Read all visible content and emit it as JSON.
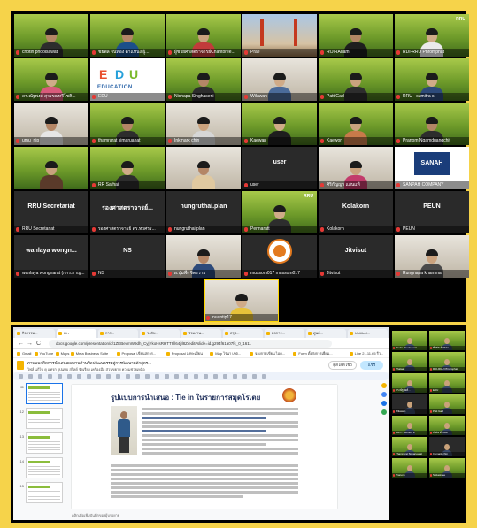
{
  "top_gallery": {
    "tiles": [
      {
        "name": "chotin phoolsawat",
        "style": "green",
        "person": true,
        "skin": "#b48666",
        "shirt": "#2d2d2d"
      },
      {
        "name": "ชัยพล จันทอง ตำแหน่ง ผู้...",
        "style": "green",
        "person": true,
        "skin": "#b48666",
        "shirt": "#1c4f8a"
      },
      {
        "name": "ผู้ช่วยศาสตราจารย์Chantoree...",
        "style": "green",
        "person": true,
        "skin": "#caa27e",
        "shirt": "#c23b3b"
      },
      {
        "name": "Prae",
        "style": "bridge",
        "person": false
      },
      {
        "name": "ROIRAdam",
        "style": "green",
        "person": true,
        "skin": "#b48666",
        "shirt": "#1e1e1e"
      },
      {
        "name": "RDI-RRU Phromphat",
        "style": "green",
        "person": true,
        "skin": "#d0ab88",
        "shirt": "#eaeaea",
        "logo": "RRU"
      },
      {
        "name": "ดร.ณัฐพงศ์ สุวรรณทวีโชติ...",
        "style": "green",
        "person": true,
        "skin": "#d0ab88",
        "shirt": "#d95b7b"
      },
      {
        "name": "EDU",
        "style": "edu",
        "person": false,
        "edu_sub": "EDUCATION"
      },
      {
        "name": "Nichapa Singhaseni",
        "style": "green",
        "person": true,
        "skin": "#b48666",
        "shirt": "#2d2d2d"
      },
      {
        "name": "Wilawan",
        "style": "photo",
        "person": true,
        "skin": "#d0ab88",
        "shirt": "#4b6b9a"
      },
      {
        "name": "Patt Gad",
        "style": "green",
        "person": true,
        "skin": "#caa27e",
        "shirt": "#2d2d2d"
      },
      {
        "name": "RRU - sumitra s.",
        "style": "green",
        "person": true,
        "skin": "#d0ab88",
        "shirt": "#2d4a7a"
      },
      {
        "name": "umu_nip",
        "style": "photo",
        "person": true,
        "skin": "#b48666",
        "shirt": "#e6e6e6"
      },
      {
        "name": "thamrarat simaruanat",
        "style": "green",
        "person": true,
        "skin": "#b48666",
        "shirt": "#2d2d2d"
      },
      {
        "name": "Inkmark chin",
        "style": "photo",
        "person": true,
        "skin": "#caa27e",
        "shirt": "#d6d6d6"
      },
      {
        "name": "Kaewan",
        "style": "green",
        "person": true,
        "skin": "#d0ab88",
        "shirt": "#1e1e1e"
      },
      {
        "name": "Kaewon",
        "style": "green",
        "person": true,
        "skin": "#caa27e",
        "shirt": "#c87a4a"
      },
      {
        "name": "Pranom Ngamduangchit",
        "style": "green",
        "person": true,
        "skin": "#b48666",
        "shirt": "#2d2d2d"
      },
      {
        "name": "",
        "style": "green",
        "person": true,
        "skin": "#caa27e",
        "shirt": "#5a3a2a"
      },
      {
        "name": "RR Sarhail",
        "style": "green",
        "person": true,
        "skin": "#d0ab88",
        "shirt": "#2d2d2d"
      },
      {
        "name": "",
        "style": "photo",
        "person": true,
        "skin": "#b48666",
        "shirt": "#e0c9a0"
      },
      {
        "name": "user",
        "style": "dark-label",
        "person": false,
        "label": "user"
      },
      {
        "name": "ศิริกัญญา แสนแท้",
        "style": "photo",
        "person": true,
        "skin": "#caa27e",
        "shirt": "#c23b6b"
      },
      {
        "name": "SANPAH COMPANY",
        "style": "sanah",
        "person": false
      },
      {
        "name": "RRU Secretariat",
        "style": "dark-label",
        "person": false,
        "label": "RRU Secretariat"
      },
      {
        "name": "รองศาสตราจารย์ ดร.ทวศรร...",
        "style": "dark-label",
        "person": false,
        "label": "รองศาสตราจารย์..."
      },
      {
        "name": "nungruthai.plan",
        "style": "dark-label",
        "person": false,
        "label": "nungruthai.plan"
      },
      {
        "name": "Pennaratt",
        "style": "green",
        "person": true,
        "skin": "#d0ab88",
        "shirt": "#2d2d2d",
        "logo": "RRU"
      },
      {
        "name": "Kolakorn",
        "style": "dark-label",
        "person": false,
        "label": "Kolakorn"
      },
      {
        "name": "PEUN",
        "style": "dark-label",
        "person": false,
        "label": "PEUN"
      },
      {
        "name": "wanlaya wongnarat (กกร.กาญ...",
        "style": "dark-label",
        "person": false,
        "label": "wanlaya wongn..."
      },
      {
        "name": "NS",
        "style": "dark-label",
        "person": false,
        "label": "NS"
      },
      {
        "name": "ผ.ปุ่มพึ่ง จิตรวาย",
        "style": "photo",
        "person": true,
        "skin": "#b48666",
        "shirt": "#2d4a7a"
      },
      {
        "name": "mussom017 mussom017",
        "style": "seal",
        "person": false
      },
      {
        "name": "Jitvisut",
        "style": "dark-label",
        "person": false,
        "label": "Jitvisut"
      },
      {
        "name": "Rungnapa khamma",
        "style": "photo",
        "person": true,
        "skin": "#caa27e",
        "shirt": "#4a4a4a"
      },
      {
        "name": "nuantip17",
        "style": "photo",
        "person": true,
        "skin": "#d0ab88",
        "shirt": "#e8c23a",
        "highlight": true
      }
    ]
  },
  "browser": {
    "tabs": [
      {
        "label": "กิจกรรม..."
      },
      {
        "label": "bfn"
      },
      {
        "label": "การ..."
      },
      {
        "label": "ระดับ..."
      },
      {
        "label": "ร่วมงาน..."
      },
      {
        "label": "สรุป..."
      },
      {
        "label": "ผลการ..."
      },
      {
        "label": "ศูนย์..."
      },
      {
        "label": "Untitled..."
      }
    ],
    "url": "docs.google.com/presentation/d/1ZEBevmW9dh_CyjYkoHsRHTT9ll64jIl8Z/edit#slide=id.g294f61a07fc_0_1611",
    "back": "←",
    "forward": "→",
    "reload": "C",
    "bookmarks": [
      {
        "label": "Gmail"
      },
      {
        "label": "YouTube"
      },
      {
        "label": "Maps"
      },
      {
        "label": "Meta Business Suite"
      },
      {
        "label": "Proposal เขียนสการ..."
      },
      {
        "label": "Proposal ลงทะเบียน"
      },
      {
        "label": "Map ไร่นา เขต..."
      },
      {
        "label": "จองการเขียน ไอต..."
      },
      {
        "label": "Form ตั้งส่งการเยี่ยม..."
      },
      {
        "label": "Line 21.11.65 รีว..."
      }
    ]
  },
  "slides": {
    "doc_title": "ภาพแนวคิดการนำเสนอผลงานด้านศิลปวัฒนธรรมสู่การพัฒนาหลักสูตร...",
    "menu": "ไฟล์  แก้ไข  ดู  แทรก  รูปแบบ  สไลด์  จัดเรียง  เครื่องมือ  ส่วนขยาย  ความช่วยเหลือ",
    "present_label": "ดูสไลด์โชว์",
    "share_label": "แชร์",
    "slide_numbers": [
      "11",
      "12",
      "13",
      "14",
      "15"
    ],
    "slide_title": "รูปแบบการนำเสนอ : Tie in ในรายการสมุดโรเตย",
    "notes_text": "คลิกเพื่อเพิ่มบันทึกของผู้บรรยาย"
  },
  "side_gallery": {
    "tiles": [
      {
        "name": "chotin phoolsawat",
        "style": "green"
      },
      {
        "name": "ชัยพล จันทอง",
        "style": "green"
      },
      {
        "name": "Phalaat",
        "style": "green"
      },
      {
        "name": "RDI-RRU Phromphat",
        "style": "green"
      },
      {
        "name": "ดร.ณัฐพงศ์...",
        "style": "green"
      },
      {
        "name": "EDU",
        "style": "green"
      },
      {
        "name": "Wilawan",
        "style": "dark"
      },
      {
        "name": "Patt Gad",
        "style": "green"
      },
      {
        "name": "RRU - sumitra s.",
        "style": "green"
      },
      {
        "name": "ส่งต่อ ตัวรอย",
        "style": "green"
      },
      {
        "name": "Thamrarat Simaruanat",
        "style": "green"
      },
      {
        "name": "Inkmark chin",
        "style": "dark"
      },
      {
        "name": "Pranom",
        "style": "green"
      },
      {
        "name": "Suttasinee",
        "style": "green"
      }
    ]
  },
  "colors": {
    "background": "#f6d34a",
    "accent_green": "#6e9b2a",
    "mic_red": "#e53935"
  }
}
